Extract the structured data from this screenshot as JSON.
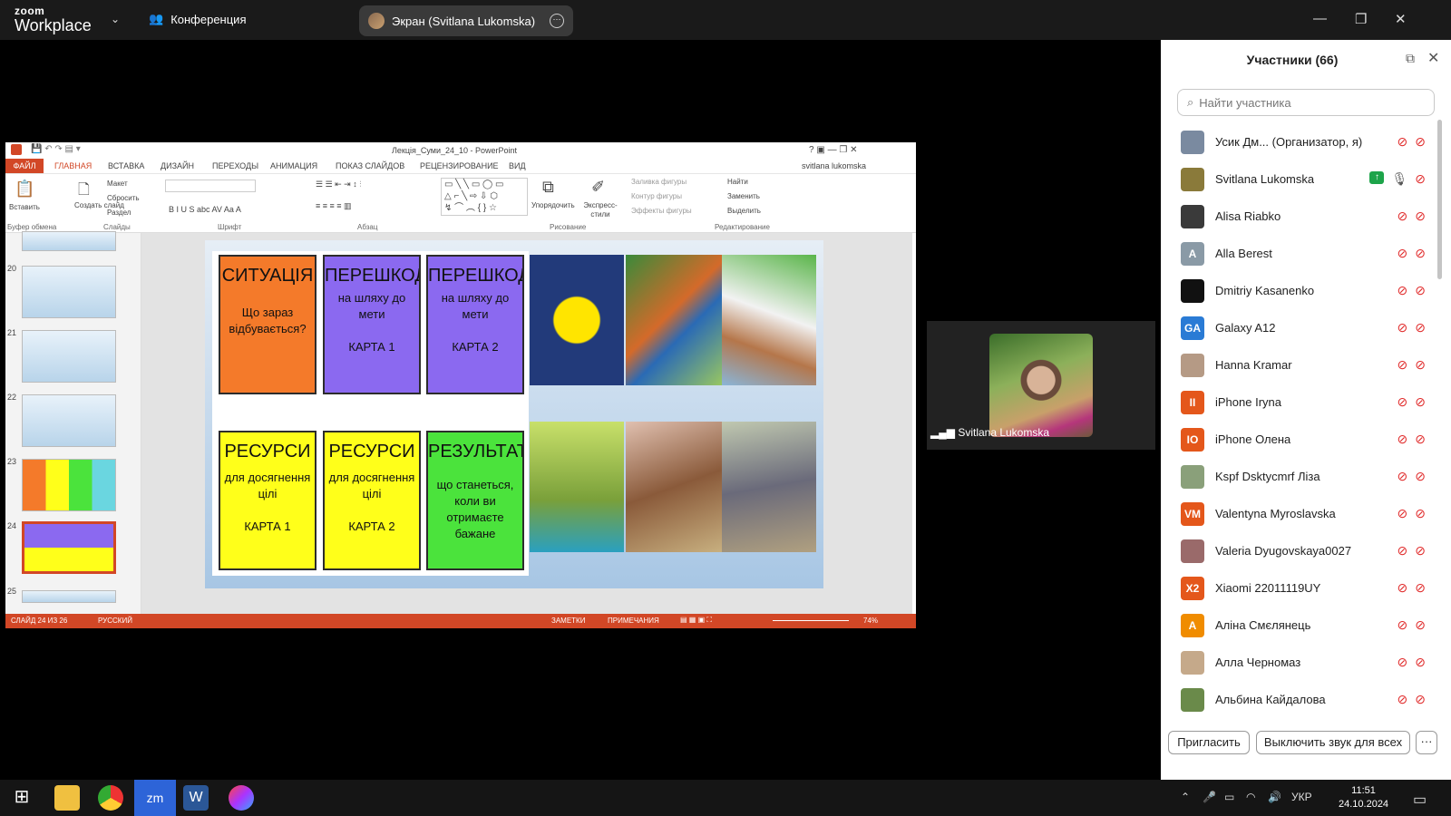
{
  "zoom": {
    "logo_top": "zoom",
    "logo_bottom": "Workplace",
    "meeting_label": "Конференция",
    "share_label": "Экран (Svitlana Lukomska)"
  },
  "participants": {
    "title": "Участники (66)",
    "search_placeholder": "Найти участника",
    "list": [
      {
        "name": "Усик Дм...  (Организатор, я)",
        "initials": "",
        "color": "#7a8aa0"
      },
      {
        "name": "Svitlana Lukomska",
        "initials": "",
        "color": "#8a7a3a"
      },
      {
        "name": "Alisa Riabko",
        "initials": "",
        "color": "#3a3a3a"
      },
      {
        "name": "Alla Berest",
        "initials": "A",
        "color": "#8a9aa6"
      },
      {
        "name": "Dmitriy Kasanenko",
        "initials": "",
        "color": "#111111"
      },
      {
        "name": "Galaxy A12",
        "initials": "GA",
        "color": "#2a7bd5"
      },
      {
        "name": "Hanna Kramar",
        "initials": "",
        "color": "#b59a85"
      },
      {
        "name": "iPhone Iryna",
        "initials": "II",
        "color": "#e4571b"
      },
      {
        "name": "iPhone Олена",
        "initials": "IO",
        "color": "#e4571b"
      },
      {
        "name": "Kspf Dsktycmrf Ліза",
        "initials": "",
        "color": "#8aa07a"
      },
      {
        "name": "Valentyna Myroslavska",
        "initials": "VM",
        "color": "#e4571b"
      },
      {
        "name": "Valeria Dyugovskaya0027",
        "initials": "",
        "color": "#9a6a6a"
      },
      {
        "name": "Xiaomi 22011119UY",
        "initials": "X2",
        "color": "#e4571b"
      },
      {
        "name": "Аліна Смєлянець",
        "initials": "A",
        "color": "#f08c00"
      },
      {
        "name": "Алла Черномаз",
        "initials": "",
        "color": "#c5a98a"
      },
      {
        "name": "Альбина Кайдалова",
        "initials": "",
        "color": "#6a8a4a"
      }
    ],
    "invite_label": "Пригласить",
    "mute_all_label": "Выключить звук для всех",
    "more_label": "···"
  },
  "video": {
    "name": "Svitlana Lukomska"
  },
  "ppt": {
    "title": "Лекція_Суми_24_10 - PowerPoint",
    "user": "svitlana lukomska",
    "tabs": [
      "ФАЙЛ",
      "ГЛАВНАЯ",
      "ВСТАВКА",
      "ДИЗАЙН",
      "ПЕРЕХОДЫ",
      "АНИМАЦИЯ",
      "ПОКАЗ СЛАЙДОВ",
      "РЕЦЕНЗИРОВАНИЕ",
      "ВИД"
    ],
    "ribbon": {
      "paste": "Вставить",
      "clipboard": "Буфер обмена",
      "new_slide": "Создать слайд",
      "layout": "Макет",
      "reset": "Сбросить",
      "section": "Раздел",
      "slides": "Слайды",
      "font": "Шрифт",
      "paragraph": "Абзац",
      "arrange": "Упорядочить",
      "quick_styles": "Экспресс-стили",
      "shape_fill": "Заливка фигуры",
      "shape_outline": "Контур фигуры",
      "shape_effects": "Эффекты фигуры",
      "drawing": "Рисование",
      "find": "Найти",
      "replace": "Заменить",
      "select": "Выделить",
      "editing": "Редактирование"
    },
    "thumb_numbers": [
      "20",
      "21",
      "22",
      "23",
      "24",
      "25"
    ],
    "status": {
      "slide": "СЛАЙД 24 ИЗ 26",
      "lang": "РУССКИЙ",
      "notes": "ЗАМЕТКИ",
      "comments": "ПРИМЕЧАНИЯ",
      "zoom": "74%"
    },
    "cards": [
      {
        "head": "СИТУАЦІЯ",
        "sub": "Що зараз відбувається?",
        "color": "#f47a2a"
      },
      {
        "head": "ПЕРЕШКОДИ",
        "sub": "на шляху до мети\n\nКАРТА 1",
        "color": "#8b69f0"
      },
      {
        "head": "ПЕРЕШКОДИ",
        "sub": "на шляху до мети\n\nКАРТА 2",
        "color": "#8b69f0"
      },
      {
        "head": "РЕСУРСИ",
        "sub": "для досягнення цілі\n\nКАРТА 1",
        "color": "#ffff1a"
      },
      {
        "head": "РЕСУРСИ",
        "sub": "для досягнення цілі\n\nКАРТА 2",
        "color": "#ffff1a"
      },
      {
        "head": "РЕЗУЛЬТАТ",
        "sub": "що станеться, коли ви отримаєте бажане",
        "color": "#4be33c"
      }
    ]
  },
  "taskbar": {
    "lang": "УКР",
    "time": "11:51",
    "date": "24.10.2024"
  }
}
